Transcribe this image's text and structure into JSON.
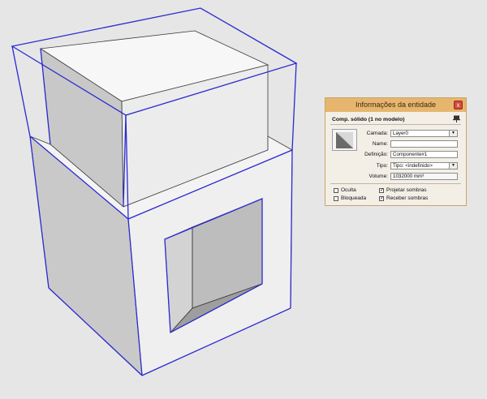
{
  "panel": {
    "title": "Informações da entidade",
    "close_glyph": "x",
    "header": "Comp. sólido (1 no modelo)",
    "pin_icon": "pin-icon",
    "fields": {
      "camada_label": "Camada:",
      "camada_value": "Layer0",
      "name_label": "Name:",
      "name_value": "",
      "definicao_label": "Definição:",
      "definicao_value": "Componente#1",
      "tipo_label": "Tipo:",
      "tipo_value": "Tipo: <indefinido>",
      "volume_label": "Volume:",
      "volume_value": "1032000 mm³"
    },
    "checkboxes": {
      "oculta": {
        "label": "Oculta",
        "checked": false
      },
      "bloqueada": {
        "label": "Bloqueada",
        "checked": false
      },
      "projetar": {
        "label": "Projetar sombras",
        "checked": true
      },
      "receber": {
        "label": "Receber sombras",
        "checked": true
      }
    }
  },
  "colors": {
    "background": "#e6e6e6",
    "selection_box": "#2a2ad0",
    "panel_title_bar": "#e7b66e",
    "close_button": "#d04a3a"
  }
}
